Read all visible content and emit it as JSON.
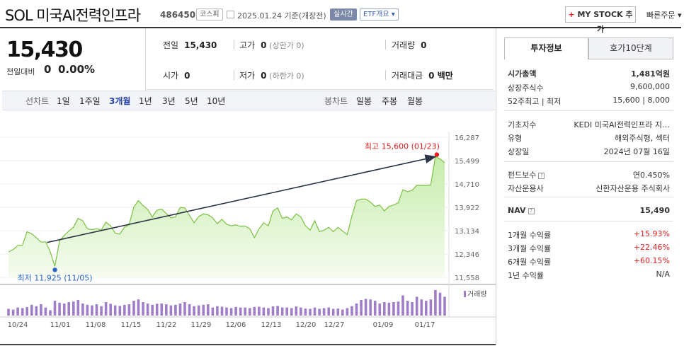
{
  "header": {
    "title": "SOL 미국AI전력인프라",
    "code": "486450",
    "market": "코스피",
    "date": "2025.01.24 기준(개장전)",
    "realtime": "실시간",
    "etf_overview": "ETF개요 ▾",
    "mystock_plus": "+",
    "mystock": "MY STOCK 추가",
    "quick_order": "빠른주문 ▾"
  },
  "price": {
    "current": "15,430",
    "change_label": "전일대비",
    "change_arrow": "━",
    "change_value": "0",
    "change_pct": "0.00%"
  },
  "summary": {
    "prev_label": "전일",
    "prev_value": "15,430",
    "high_label": "고가",
    "high_value": "0",
    "high_sub": "(상한가 0)",
    "volume_label": "거래량",
    "volume_value": "0",
    "open_label": "시가",
    "open_value": "0",
    "low_label": "저가",
    "low_value": "0",
    "low_sub": "(하한가 0)",
    "amount_label": "거래대금",
    "amount_value": "0 백만"
  },
  "periods": {
    "line_label": "선차트",
    "line_items": [
      "1일",
      "1주일",
      "3개월",
      "1년",
      "3년",
      "5년",
      "10년"
    ],
    "selected": "3개월",
    "candle_label": "봉차트",
    "candle_items": [
      "일봉",
      "주봉",
      "월봉"
    ]
  },
  "chart_data": {
    "type": "area",
    "y_ticks": [
      "16,287",
      "15,499",
      "14,710",
      "13,922",
      "13,134",
      "12,346",
      "11,558"
    ],
    "ylim": [
      11558,
      16287
    ],
    "x_ticks": [
      "10/24",
      "11/01",
      "11/08",
      "11/15",
      "11/22",
      "11/29",
      "12/06",
      "12/13",
      "12/20",
      "12/27",
      "01/09",
      "01/17"
    ],
    "max_label": "최고 15,600 (01/23)",
    "min_label": "최저 11,925 (11/05)",
    "volume_legend": "거래량",
    "values": [
      12420,
      12500,
      12630,
      12650,
      13100,
      13030,
      12900,
      12750,
      12760,
      12420,
      11930,
      12780,
      12970,
      13120,
      13250,
      13550,
      13470,
      13200,
      13170,
      13200,
      13160,
      13420,
      13300,
      13050,
      13020,
      13250,
      13330,
      13930,
      14150,
      13980,
      13850,
      13600,
      13830,
      13860,
      13720,
      13570,
      13600,
      13920,
      13900,
      13650,
      13400,
      13610,
      13700,
      13670,
      13570,
      13370,
      13520,
      13350,
      13300,
      13330,
      13280,
      13290,
      13200,
      12900,
      13200,
      13400,
      13300,
      13800,
      13900,
      13550,
      13600,
      13500,
      13700,
      13600,
      13300,
      13150,
      13470,
      13100,
      13150,
      13250,
      13100,
      13250,
      13120,
      13000,
      13620,
      14150,
      14200,
      14200,
      14100,
      13950,
      14000,
      13800,
      13950,
      14000,
      14080,
      14520,
      14450,
      14500,
      14670,
      14660,
      14660,
      14680,
      15630,
      15560,
      15430
    ],
    "volume": [
      0.25,
      0.22,
      0.3,
      0.28,
      0.32,
      0.4,
      0.35,
      0.42,
      0.3,
      0.2,
      0.55,
      0.48,
      0.45,
      0.5,
      0.52,
      0.58,
      0.45,
      0.4,
      0.38,
      0.42,
      0.35,
      0.5,
      0.44,
      0.38,
      0.36,
      0.4,
      0.42,
      0.55,
      0.6,
      0.5,
      0.45,
      0.4,
      0.44,
      0.45,
      0.42,
      0.38,
      0.4,
      0.45,
      0.5,
      0.42,
      0.35,
      0.38,
      0.4,
      0.42,
      0.3,
      0.35,
      0.33,
      0.3,
      0.28,
      0.32,
      0.3,
      0.3,
      0.28,
      0.32,
      0.33,
      0.3,
      0.28,
      0.34,
      0.36,
      0.3,
      0.3,
      0.28,
      0.34,
      0.3,
      0.26,
      0.25,
      0.3,
      0.25,
      0.28,
      0.3,
      0.25,
      0.26,
      0.22,
      0.28,
      0.35,
      0.45,
      0.58,
      0.62,
      0.6,
      0.55,
      0.45,
      0.5,
      0.48,
      0.5,
      0.52,
      0.75,
      0.55,
      0.5,
      0.7,
      0.6,
      0.55,
      0.6,
      0.95,
      0.85,
      0.7
    ],
    "colors": {
      "line": "#7bc142",
      "fill_top": "#c6ecab",
      "fill_bottom": "#f6fcf0",
      "volume": "#a07ec9",
      "max": "#e02020",
      "min": "#2a63c7",
      "arrow": "#2b3545"
    }
  },
  "panel": {
    "tab_active": "투자정보",
    "tab_other": "호가10단계",
    "rows": [
      {
        "label": "시가총액",
        "value": "1,481억원",
        "bold": true
      },
      {
        "label": "상장주식수",
        "value": "9,600,000"
      },
      {
        "label": "52주최고 | 최저",
        "value": "15,600 | 8,000"
      },
      {
        "label": "기초지수",
        "value": "KEDI 미국AI전력인프라 지…"
      },
      {
        "label": "유형",
        "value": "해외주식형, 섹터"
      },
      {
        "label": "상장일",
        "value": "2024년 07월 16일"
      },
      {
        "label": "펀드보수",
        "value": "연0.450%",
        "help": true
      },
      {
        "label": "자산운용사",
        "value": "신한자산운용 주식회사"
      },
      {
        "label": "NAV",
        "value": "15,490",
        "bold": true,
        "help": true
      },
      {
        "label": "1개월 수익률",
        "value": "+15.93%",
        "red": true
      },
      {
        "label": "3개월 수익률",
        "value": "+22.46%",
        "red": true
      },
      {
        "label": "6개월 수익률",
        "value": "+60.15%",
        "red": true
      },
      {
        "label": "1년 수익률",
        "value": "N/A"
      }
    ],
    "help_glyph": "?"
  }
}
